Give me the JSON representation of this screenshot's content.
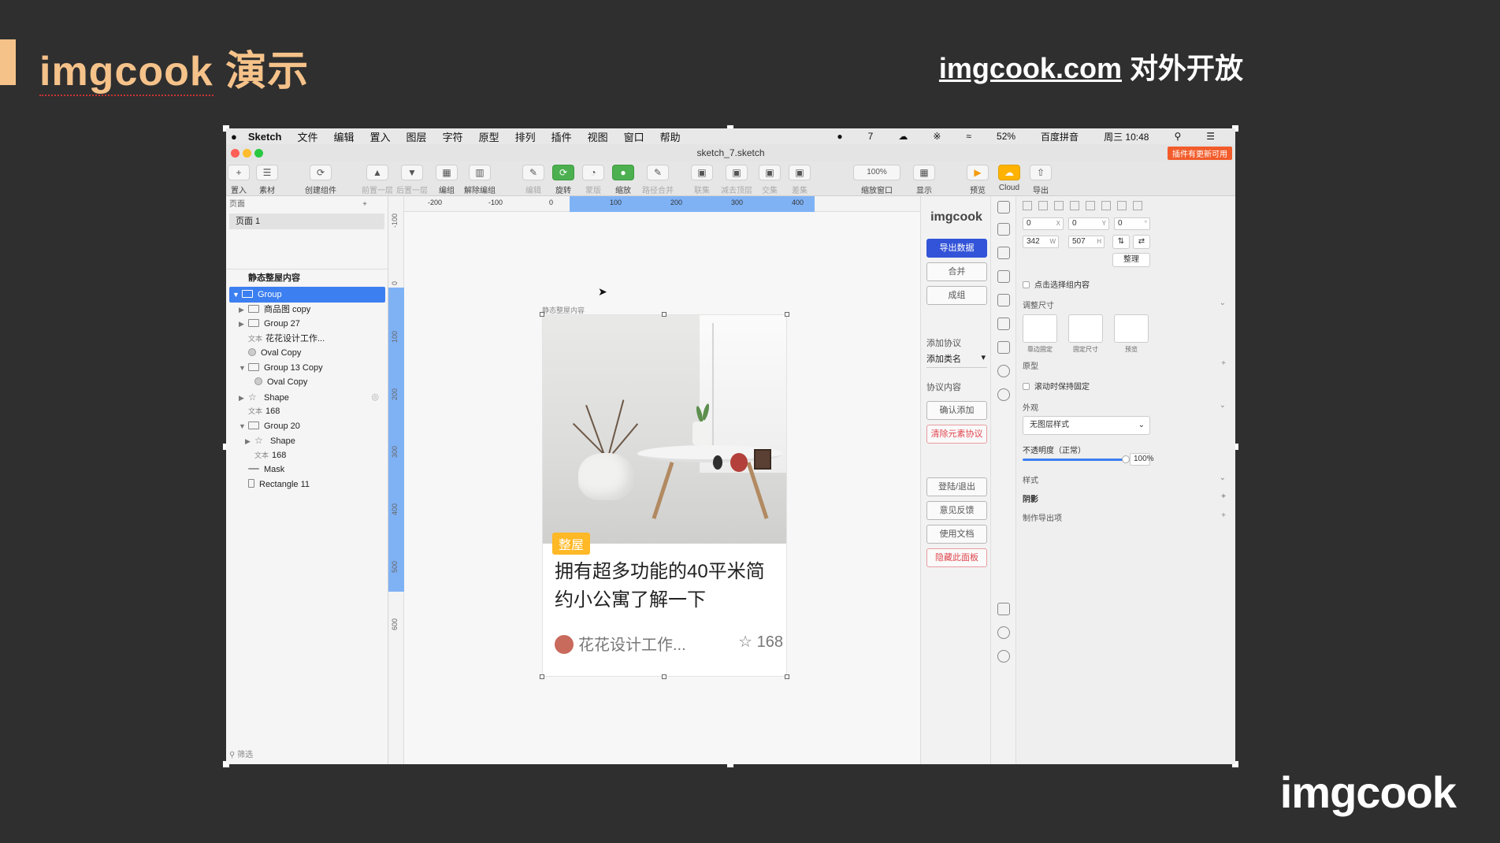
{
  "slide": {
    "title_word": "imgcook",
    "title_rest": " 演示",
    "subtitle_link": "imgcook.com",
    "subtitle_rest": " 对外开放",
    "logo": "imgcook",
    "accent": "#f5c28a"
  },
  "menubar": {
    "app": "Sketch",
    "items": [
      "文件",
      "编辑",
      "置入",
      "图层",
      "字符",
      "原型",
      "排列",
      "插件",
      "视图",
      "窗口",
      "帮助"
    ],
    "right": {
      "badge": "7",
      "battery": "52%",
      "ime": "百度拼音",
      "clock": "周三 10:48"
    }
  },
  "window": {
    "doc_title": "sketch_7.sketch",
    "update_badge": "插件有更新可用"
  },
  "toolbar": {
    "insert": "置入",
    "assets": "素材",
    "create_symbol": "创建组件",
    "forward": "前置一层",
    "backward": "后置一层",
    "group": "编组",
    "ungroup": "解除编组",
    "edit": "编辑",
    "rotate": "旋转",
    "mask": "蒙版",
    "scale": "缩放",
    "flatten": "路径合并",
    "union": "联集",
    "subtract": "减去顶层",
    "intersect": "交集",
    "difference": "差集",
    "zoom_value": "100%",
    "zoom": "缩放窗口",
    "view": "显示",
    "preview": "预览",
    "cloud": "Cloud",
    "export": "导出"
  },
  "left_panel": {
    "pages_label": "页面",
    "page": "页面 1",
    "artboard": "静态整屋内容",
    "filter": "筛选",
    "layers": [
      {
        "name": "Group",
        "type": "group",
        "indent": 0,
        "selected": true,
        "expanded": true
      },
      {
        "name": "商品图 copy",
        "type": "group",
        "indent": 1,
        "expanded": false
      },
      {
        "name": "Group 27",
        "type": "group",
        "indent": 1,
        "expanded": false
      },
      {
        "name": "花花设计工作...",
        "type": "text",
        "indent": 1
      },
      {
        "name": "Oval Copy",
        "type": "oval",
        "indent": 1
      },
      {
        "name": "Group 13 Copy",
        "type": "group",
        "indent": 1,
        "expanded": true
      },
      {
        "name": "Oval Copy",
        "type": "oval",
        "indent": 2
      },
      {
        "name": "Shape",
        "type": "shape",
        "indent": 1,
        "expanded": false,
        "hidden": true
      },
      {
        "name": "168",
        "type": "text",
        "indent": 1
      },
      {
        "name": "Group 20",
        "type": "group",
        "indent": 1,
        "expanded": true
      },
      {
        "name": "Shape",
        "type": "shape",
        "indent": 2,
        "expanded": false
      },
      {
        "name": "168",
        "type": "text",
        "indent": 2
      },
      {
        "name": "Mask",
        "type": "mask",
        "indent": 1
      },
      {
        "name": "Rectangle 11",
        "type": "rect",
        "indent": 1
      }
    ],
    "text_tag": "文本"
  },
  "rulers": {
    "h": [
      "-200",
      "-100",
      "0",
      "100",
      "200",
      "300",
      "400"
    ],
    "v": [
      "-100",
      "0",
      "100",
      "200",
      "300",
      "400",
      "500",
      "600"
    ]
  },
  "canvas": {
    "artboard_label": "静态整屋内容",
    "card": {
      "tag": "整屋",
      "title": "拥有超多功能的40平米简约小公寓了解一下",
      "author": "花花设计工作...",
      "likes": "168"
    }
  },
  "plugin": {
    "logo": "imgcook",
    "export_data": "导出数据",
    "merge": "合并",
    "make_group": "成组",
    "add_protocol": "添加协议",
    "add_class": "添加类名",
    "protocol_content": "协议内容",
    "confirm_add": "确认添加",
    "clear_protocol": "清除元素协议",
    "login": "登陆/退出",
    "feedback": "意见反馈",
    "docs": "使用文档",
    "hide_panel": "隐藏此面板"
  },
  "inspector": {
    "x": "0",
    "y": "0",
    "rot": "0",
    "w": "342",
    "h": "507",
    "tidy": "整理",
    "click_select": "点击选择组内容",
    "resizing": "调整尺寸",
    "resize_opts": [
      "靠边固定",
      "固定尺寸",
      "预览"
    ],
    "prototype": "原型",
    "fix_scroll": "滚动时保持固定",
    "appearance": "外观",
    "layer_style": "无图层样式",
    "opacity_label": "不透明度（正常）",
    "opacity": "100%",
    "style": "样式",
    "shadow": "阴影",
    "export": "制作导出项"
  }
}
